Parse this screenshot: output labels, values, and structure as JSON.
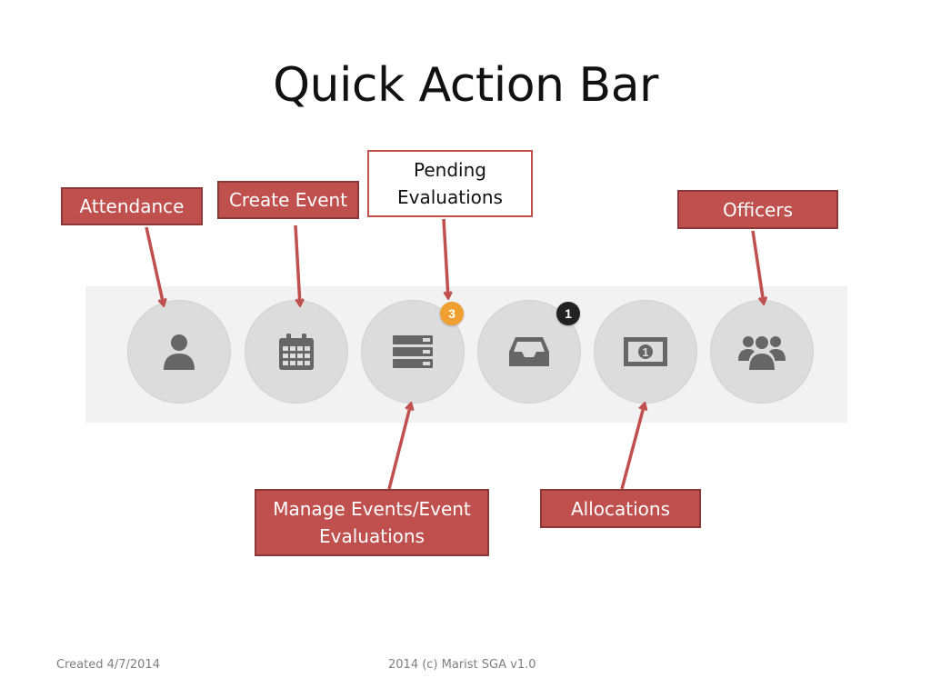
{
  "slide": {
    "title": "Quick Action Bar"
  },
  "callouts": {
    "attendance": "Attendance",
    "create_event": "Create Event",
    "pending_evaluations": "Pending Evaluations",
    "officers": "Officers",
    "manage_events": "Manage Events/Event Evaluations",
    "allocations": "Allocations"
  },
  "action_bar": {
    "badges": {
      "pending_evaluations": "3",
      "inbox": "1"
    },
    "icons": [
      "user-icon",
      "calendar-icon",
      "list-icon",
      "inbox-icon",
      "money-icon",
      "group-icon"
    ]
  },
  "colors": {
    "callout_red": "#c0504d",
    "badge_orange": "#f0a030",
    "badge_dark": "#222222",
    "icon_gray": "#666666",
    "button_bg": "#dcdcdc"
  },
  "footer": {
    "created": "Created 4/7/2014",
    "copyright": "2014 (c) Marist SGA v1.0"
  }
}
